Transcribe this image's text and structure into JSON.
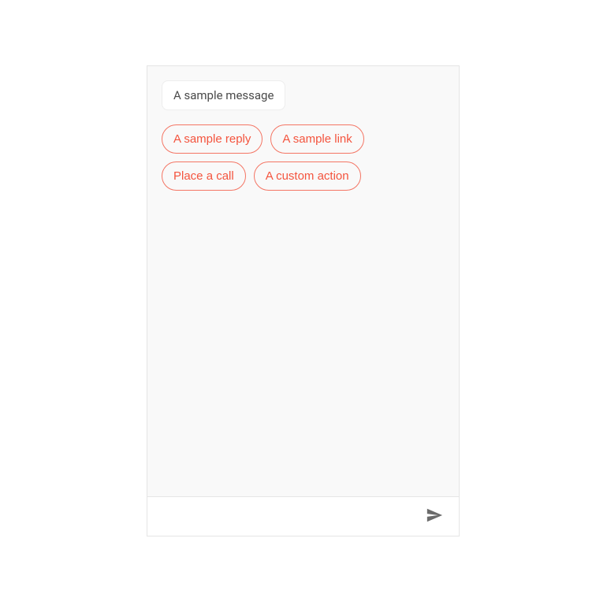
{
  "message": {
    "text": "A sample message"
  },
  "actions": [
    {
      "label": "A sample reply"
    },
    {
      "label": "A sample link"
    },
    {
      "label": "Place a call"
    },
    {
      "label": "A custom action"
    }
  ],
  "colors": {
    "accent": "#f4543e",
    "accent_border": "#f47564",
    "panel_bg": "#f9f9f9",
    "border": "#e5e5e5",
    "text": "#4a4a4a",
    "icon": "#6b6b6b"
  }
}
